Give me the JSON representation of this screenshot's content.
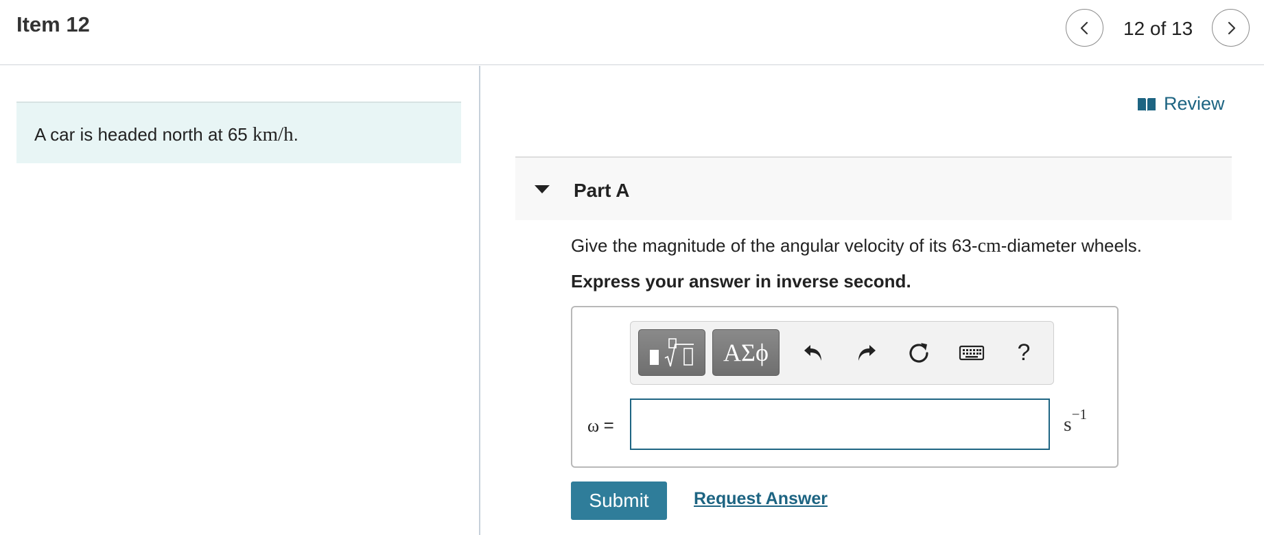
{
  "header": {
    "item_title": "Item 12",
    "page_count": "12 of 13",
    "prev_icon": "chevron-left-icon",
    "next_icon": "chevron-right-icon"
  },
  "intro": {
    "text_prefix": "A car is headed north at 65 ",
    "math": "km/h",
    "text_suffix": "."
  },
  "review": {
    "icon": "open-book-icon",
    "label": "Review"
  },
  "part": {
    "title": "Part A",
    "question_prefix": "Give the magnitude of the angular velocity of its 63-",
    "question_math": "cm",
    "question_suffix": "-diameter wheels.",
    "instruction": "Express your answer in inverse second."
  },
  "toolbar": {
    "templates_icon": "templates-icon",
    "greek_label": "ΑΣϕ",
    "undo_icon": "undo-icon",
    "redo_icon": "redo-icon",
    "reset_icon": "reset-icon",
    "keyboard_icon": "keyboard-icon",
    "help_label": "?"
  },
  "answer": {
    "variable": "ω",
    "equals": "=",
    "value": "",
    "unit": "s",
    "unit_exponent": "−1"
  },
  "actions": {
    "submit_label": "Submit",
    "request_answer_label": "Request Answer"
  },
  "colors": {
    "accent": "#1d6482",
    "submit_bg": "#2f7d9a",
    "intro_bg": "#e8f5f5",
    "part_bg": "#f8f8f8"
  }
}
